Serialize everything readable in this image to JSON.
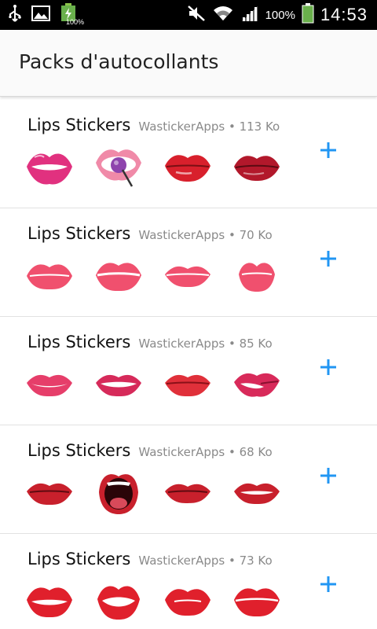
{
  "status_bar": {
    "battery_small_label": "100%",
    "battery_percent": "100%",
    "time": "14:53",
    "icons": [
      "usb-icon",
      "image-icon",
      "battery-charging-icon",
      "mute-icon",
      "wifi-icon",
      "signal-icon",
      "battery-icon"
    ]
  },
  "app_bar": {
    "title": "Packs d'autocollants"
  },
  "colors": {
    "accent": "#2196F3",
    "lip_pink": "#E63E78",
    "lip_red": "#D8202C",
    "lip_dark_red": "#B2182B",
    "lip_coral": "#F0506E"
  },
  "packs": [
    {
      "name": "Lips Stickers",
      "meta": "WastickerApps • 113 Ko",
      "add_icon": "plus-icon",
      "stickers": [
        "lips-magenta-biting",
        "lips-lollipop",
        "lips-red-glossy",
        "lips-dark-red"
      ]
    },
    {
      "name": "Lips Stickers",
      "meta": "WastickerApps • 70 Ko",
      "add_icon": "plus-icon",
      "stickers": [
        "lips-pink-1",
        "lips-pink-2",
        "lips-pink-3",
        "lips-pink-4"
      ]
    },
    {
      "name": "Lips Stickers",
      "meta": "WastickerApps • 85 Ko",
      "add_icon": "plus-icon",
      "stickers": [
        "lips-pink-smile",
        "lips-pink-open",
        "lips-red-closed",
        "lips-biting-tongue"
      ]
    },
    {
      "name": "Lips Stickers",
      "meta": "WastickerApps • 68 Ko",
      "add_icon": "plus-icon",
      "stickers": [
        "lips-red-smile",
        "lips-open-mouth",
        "lips-red-thin",
        "lips-red-teeth"
      ]
    },
    {
      "name": "Lips Stickers",
      "meta": "WastickerApps • 73 Ko",
      "add_icon": "plus-icon",
      "stickers": [
        "lips-red-outline",
        "lips-red-open",
        "lips-red-pucker",
        "lips-red-kiss"
      ]
    }
  ]
}
